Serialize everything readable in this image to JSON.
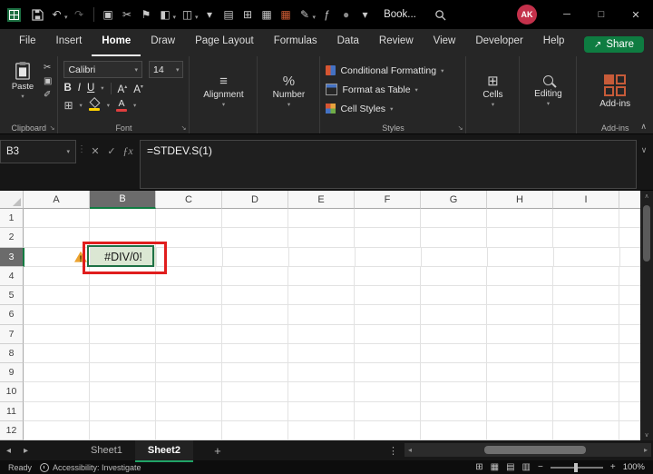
{
  "window": {
    "workbook_name": "Book...",
    "avatar_initials": "AK",
    "minimize": "─",
    "maximize": "□",
    "close": "✕"
  },
  "icons": {
    "caret": "▾",
    "undo": "↶",
    "redo": "↷",
    "scissors": "✂",
    "copy": "▣",
    "format_painter": "✐",
    "flag": "⚑",
    "borders": "⊞",
    "align": "≡",
    "percent": "%",
    "grid": "⊞",
    "check": "✓",
    "cancel": "✕",
    "fx": "ƒx",
    "dots_v": "⋮",
    "chevron_up": "∧",
    "chevron_down": "∨",
    "left": "◂",
    "right": "▸",
    "launcher": "↘",
    "share_arrow": "↗",
    "grow_caret": "▴",
    "plus": "+",
    "minus": "−",
    "view_normal": "▦",
    "view_layout": "▤",
    "view_break": "▥"
  },
  "qat": [
    {
      "name": "clipboard-icon",
      "glyph": "▣",
      "caret": false
    },
    {
      "name": "cut-icon",
      "glyph": "✂",
      "caret": false
    },
    {
      "name": "flag-icon",
      "glyph": "⚑",
      "caret": false
    },
    {
      "name": "fill-color-icon",
      "glyph": "◧",
      "caret": true
    },
    {
      "name": "eraser-icon",
      "glyph": "◫",
      "caret": true
    },
    {
      "name": "style-dropdown-icon",
      "glyph": "▾",
      "caret": false
    },
    {
      "name": "printer-icon",
      "glyph": "▤",
      "caret": false
    },
    {
      "name": "insert-table-icon",
      "glyph": "⊞",
      "caret": false
    },
    {
      "name": "borders-icon",
      "glyph": "▦",
      "caret": false
    },
    {
      "name": "color-grid-icon",
      "glyph": "▦",
      "caret": false,
      "color": "#d05c34"
    },
    {
      "name": "pen-icon",
      "glyph": "✎",
      "caret": true
    },
    {
      "name": "function-icon",
      "glyph": "ƒ",
      "caret": false
    },
    {
      "name": "record-icon",
      "glyph": "●",
      "caret": false,
      "color": "#8a8a8a"
    },
    {
      "name": "more-dropdown-icon",
      "glyph": "▾",
      "caret": false
    }
  ],
  "ribbon": {
    "tabs": [
      "File",
      "Insert",
      "Home",
      "Draw",
      "Page Layout",
      "Formulas",
      "Data",
      "Review",
      "View",
      "Developer",
      "Help"
    ],
    "active_tab": "Home",
    "share_label": "Share",
    "paste_label": "Paste",
    "font_name": "Calibri",
    "font_size": "14",
    "bold": "B",
    "italic": "I",
    "underline": "U",
    "grow_font": "A",
    "shrink_font": "A",
    "font_color_letter": "A",
    "styles_buttons": [
      "Conditional Formatting",
      "Format as Table",
      "Cell Styles"
    ],
    "alignment_label": "Alignment",
    "number_label": "Number",
    "cells_label": "Cells",
    "editing_label": "Editing",
    "addins_label": "Add-ins",
    "group_labels": {
      "clipboard": "Clipboard",
      "font": "Font",
      "styles": "Styles",
      "addins": "Add-ins"
    }
  },
  "formula_bar": {
    "name_box": "B3",
    "formula": "=STDEV.S(1)"
  },
  "grid": {
    "columns": [
      "A",
      "B",
      "C",
      "D",
      "E",
      "F",
      "G",
      "H",
      "I"
    ],
    "rows": [
      "1",
      "2",
      "3",
      "4",
      "5",
      "6",
      "7",
      "8",
      "9",
      "10",
      "11",
      "12"
    ],
    "selected": {
      "column": "B",
      "row": "3",
      "cell": "B3"
    },
    "cells": {
      "B3": "#DIV/0!"
    },
    "warning_cell": "A3"
  },
  "sheet_bar": {
    "sheets": [
      {
        "name": "Sheet1",
        "active": false
      },
      {
        "name": "Sheet2",
        "active": true
      }
    ],
    "add_label": "+"
  },
  "status_bar": {
    "ready": "Ready",
    "accessibility": "Accessibility: Investigate",
    "zoom": "100%"
  },
  "colors": {
    "accent_green": "#107c41",
    "annotation_red": "#e01e1e",
    "error_cell_fill": "#dbe7d3",
    "avatar_red": "#c4314b"
  }
}
